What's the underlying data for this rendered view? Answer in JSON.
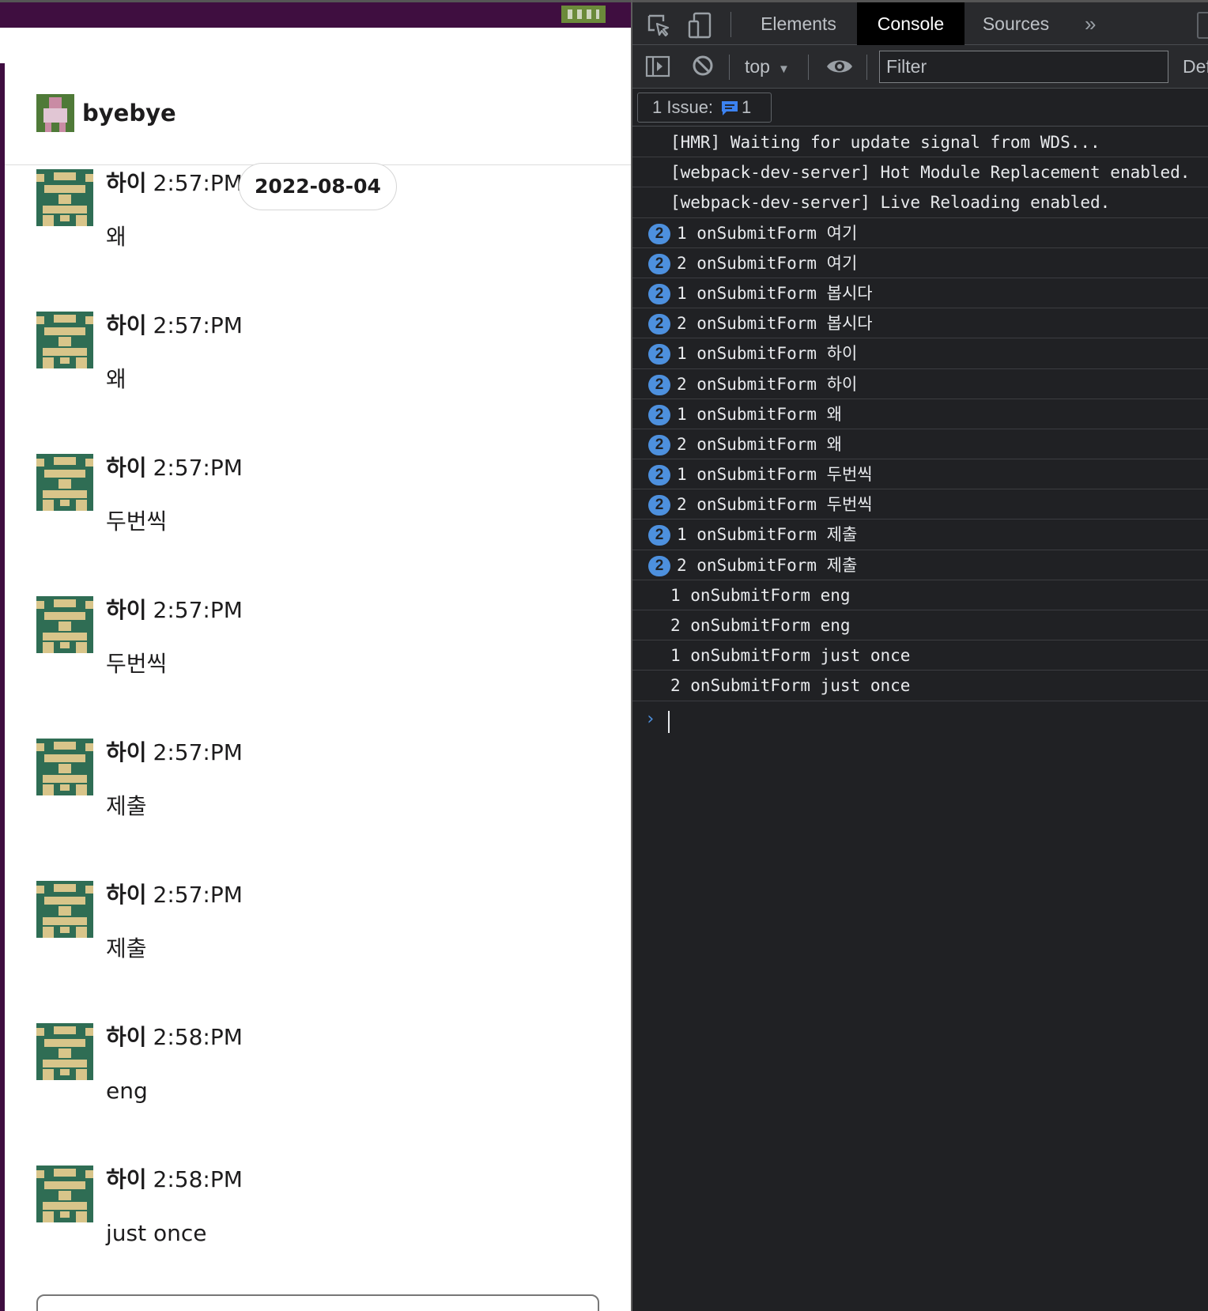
{
  "channel": {
    "name": "byebye"
  },
  "date_divider": "2022-08-04",
  "messages": [
    {
      "author": "하이",
      "time": "2:57:PM",
      "text": "왜"
    },
    {
      "author": "하이",
      "time": "2:57:PM",
      "text": "왜"
    },
    {
      "author": "하이",
      "time": "2:57:PM",
      "text": "두번씩"
    },
    {
      "author": "하이",
      "time": "2:57:PM",
      "text": "두번씩"
    },
    {
      "author": "하이",
      "time": "2:57:PM",
      "text": "제출"
    },
    {
      "author": "하이",
      "time": "2:57:PM",
      "text": "제출"
    },
    {
      "author": "하이",
      "time": "2:58:PM",
      "text": "eng"
    },
    {
      "author": "하이",
      "time": "2:58:PM",
      "text": "just once"
    }
  ],
  "devtools": {
    "tabs": {
      "elements": "Elements",
      "console": "Console",
      "sources": "Sources"
    },
    "active_tab": "Console",
    "toolbar": {
      "context": "top",
      "filter_placeholder": "Filter",
      "levels": "Default levels"
    },
    "issues": {
      "label": "1 Issue:",
      "count": "1"
    },
    "console_lines": [
      {
        "text": "[HMR] Waiting for update signal from WDS..."
      },
      {
        "text": "[webpack-dev-server] Hot Module Replacement enabled."
      },
      {
        "text": "[webpack-dev-server] Live Reloading enabled."
      },
      {
        "repeat": "2",
        "text": "1 onSubmitForm 여기"
      },
      {
        "repeat": "2",
        "text": "2 onSubmitForm 여기"
      },
      {
        "repeat": "2",
        "text": "1 onSubmitForm 봅시다"
      },
      {
        "repeat": "2",
        "text": "2 onSubmitForm 봅시다"
      },
      {
        "repeat": "2",
        "text": "1 onSubmitForm 하이"
      },
      {
        "repeat": "2",
        "text": "2 onSubmitForm 하이"
      },
      {
        "repeat": "2",
        "text": "1 onSubmitForm 왜"
      },
      {
        "repeat": "2",
        "text": "2 onSubmitForm 왜"
      },
      {
        "repeat": "2",
        "text": "1 onSubmitForm 두번씩"
      },
      {
        "repeat": "2",
        "text": "2 onSubmitForm 두번씩"
      },
      {
        "repeat": "2",
        "text": "1 onSubmitForm 제출"
      },
      {
        "repeat": "2",
        "text": "2 onSubmitForm 제출"
      },
      {
        "text": "1 onSubmitForm eng"
      },
      {
        "text": "2 onSubmitForm eng"
      },
      {
        "text": "1 onSubmitForm just once"
      },
      {
        "text": "2 onSubmitForm just once"
      }
    ],
    "prompt_symbol": "›"
  }
}
